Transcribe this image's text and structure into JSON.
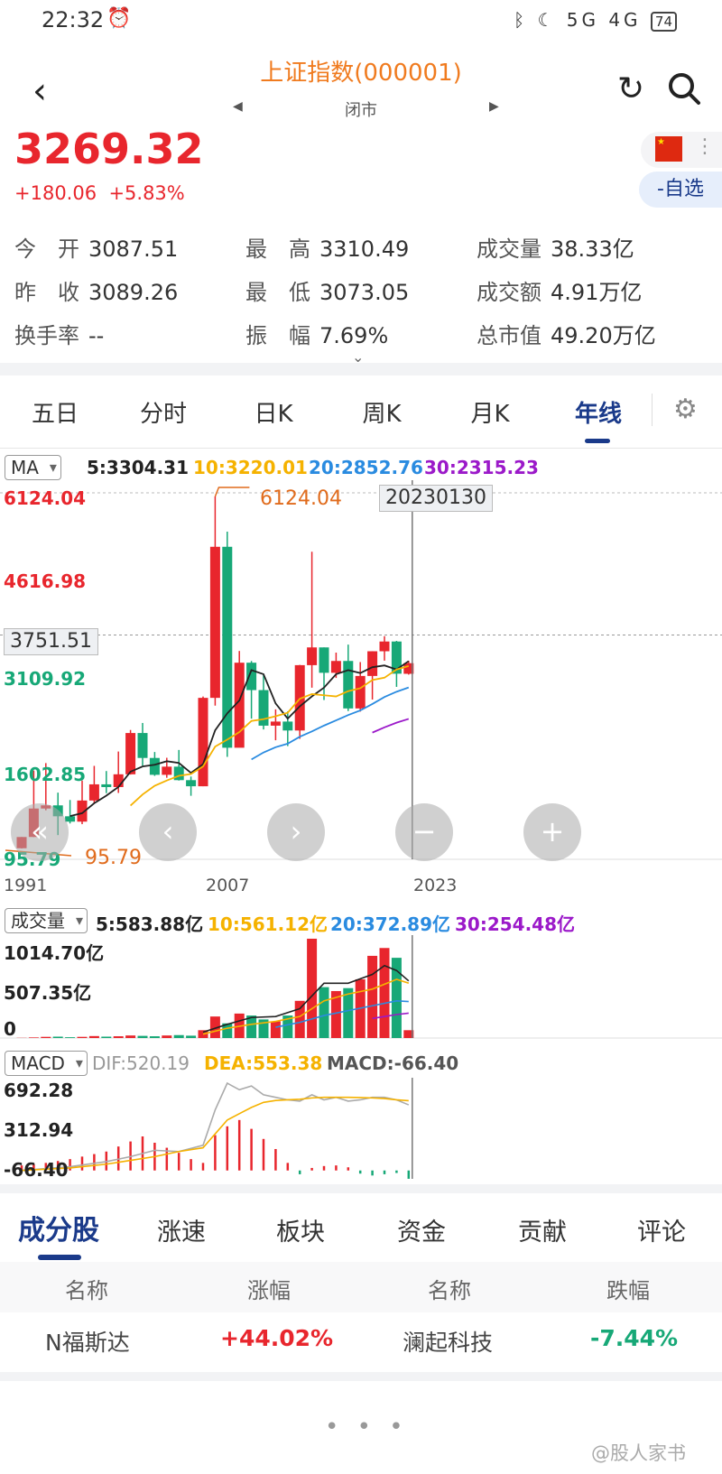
{
  "status": {
    "time": "22:32",
    "alarm_icon": "alarm-icon",
    "icons": "ᛒ ☾ 5G 4G",
    "battery": "74"
  },
  "header": {
    "title": "上证指数(000001)",
    "subtitle": "闭市",
    "back_icon": "back-icon",
    "refresh_icon": "refresh-icon",
    "search_icon": "search-icon"
  },
  "quote": {
    "price": "3269.32",
    "change": "+180.06",
    "change_pct": "+5.83%",
    "add_watch": "-自选",
    "more_icon": "more-icon",
    "stats": [
      {
        "label": "今　开",
        "value": "3087.51"
      },
      {
        "label": "最　高",
        "value": "3310.49"
      },
      {
        "label": "成交量",
        "value": "38.33亿"
      },
      {
        "label": "昨　收",
        "value": "3089.26"
      },
      {
        "label": "最　低",
        "value": "3073.05"
      },
      {
        "label": "成交额",
        "value": "4.91万亿"
      },
      {
        "label": "换手率",
        "value": "--"
      },
      {
        "label": "振　幅",
        "value": "7.69%"
      },
      {
        "label": "总市值",
        "value": "49.20万亿"
      }
    ]
  },
  "tabs": [
    "五日",
    "分时",
    "日K",
    "周K",
    "月K",
    "年线"
  ],
  "active_tab": "年线",
  "colors": {
    "up": "#e8262d",
    "down": "#17a877",
    "ma5": "#222222",
    "ma10": "#f5b200",
    "ma20": "#2a8be0",
    "ma30": "#9b19c9",
    "accent": "#1a3a8a"
  },
  "main_chart": {
    "indicator": "MA",
    "ma": [
      {
        "label": "5:3304.31",
        "color": "#222222"
      },
      {
        "label": "10:3220.01",
        "color": "#f5b200"
      },
      {
        "label": "20:2852.76",
        "color": "#2a8be0"
      },
      {
        "label": "30:2315.23",
        "color": "#9b19c9"
      }
    ],
    "y_labels": [
      "6124.04",
      "4616.98",
      "3109.92",
      "1602.85",
      "95.79"
    ],
    "max_label": "6124.04",
    "min_label": "95.79",
    "crosshair_price": "3751.51",
    "crosshair_date": "20230130",
    "x_labels": [
      "1991",
      "2007",
      "2023"
    ]
  },
  "volume_chart": {
    "indicator": "成交量",
    "ma": [
      {
        "label": "5:583.88亿",
        "color": "#222222"
      },
      {
        "label": "10:561.12亿",
        "color": "#f5b200"
      },
      {
        "label": "20:372.89亿",
        "color": "#2a8be0"
      },
      {
        "label": "30:254.48亿",
        "color": "#9b19c9"
      }
    ],
    "y_labels": [
      "1014.70亿",
      "507.35亿",
      "0"
    ]
  },
  "macd_chart": {
    "indicator": "MACD",
    "dif": "DIF:520.19",
    "dea": "DEA:553.38",
    "macd": "MACD:-66.40",
    "y_labels": [
      "692.28",
      "312.94",
      "-66.40"
    ]
  },
  "chart_controls": [
    "«",
    "‹",
    "›",
    "−",
    "+"
  ],
  "chart_data": {
    "type": "candlestick",
    "x_range": [
      1991,
      2023
    ],
    "ylim": [
      95.79,
      6124.04
    ],
    "candles": [
      {
        "year": 1991,
        "o": 100,
        "c": 292,
        "h": 292,
        "l": 96
      },
      {
        "year": 1992,
        "o": 293,
        "c": 780,
        "h": 1429,
        "l": 292
      },
      {
        "year": 1993,
        "o": 780,
        "c": 834,
        "h": 1558,
        "l": 750
      },
      {
        "year": 1994,
        "o": 834,
        "c": 647,
        "h": 1052,
        "l": 325
      },
      {
        "year": 1995,
        "o": 647,
        "c": 555,
        "h": 926,
        "l": 524
      },
      {
        "year": 1996,
        "o": 555,
        "c": 917,
        "h": 1258,
        "l": 512
      },
      {
        "year": 1997,
        "o": 917,
        "c": 1194,
        "h": 1510,
        "l": 870
      },
      {
        "year": 1998,
        "o": 1194,
        "c": 1147,
        "h": 1422,
        "l": 1043
      },
      {
        "year": 1999,
        "o": 1147,
        "c": 1366,
        "h": 1756,
        "l": 1047
      },
      {
        "year": 2000,
        "o": 1366,
        "c": 2073,
        "h": 2125,
        "l": 1361
      },
      {
        "year": 2001,
        "o": 2073,
        "c": 1646,
        "h": 2245,
        "l": 1514
      },
      {
        "year": 2002,
        "o": 1646,
        "c": 1357,
        "h": 1748,
        "l": 1339
      },
      {
        "year": 2003,
        "o": 1357,
        "c": 1497,
        "h": 1649,
        "l": 1307
      },
      {
        "year": 2004,
        "o": 1497,
        "c": 1266,
        "h": 1783,
        "l": 1259
      },
      {
        "year": 2005,
        "o": 1266,
        "c": 1161,
        "h": 1328,
        "l": 998
      },
      {
        "year": 2006,
        "o": 1161,
        "c": 2675,
        "h": 2698,
        "l": 1161
      },
      {
        "year": 2007,
        "o": 2675,
        "c": 5262,
        "h": 6124,
        "l": 2541
      },
      {
        "year": 2008,
        "o": 5262,
        "c": 1821,
        "h": 5522,
        "l": 1664
      },
      {
        "year": 2009,
        "o": 1821,
        "c": 3277,
        "h": 3478,
        "l": 1844
      },
      {
        "year": 2010,
        "o": 3277,
        "c": 2808,
        "h": 3306,
        "l": 2319
      },
      {
        "year": 2011,
        "o": 2808,
        "c": 2199,
        "h": 3067,
        "l": 2134
      },
      {
        "year": 2012,
        "o": 2199,
        "c": 2269,
        "h": 2478,
        "l": 1949
      },
      {
        "year": 2013,
        "o": 2269,
        "c": 2116,
        "h": 2444,
        "l": 1849
      },
      {
        "year": 2014,
        "o": 2116,
        "c": 3235,
        "h": 3239,
        "l": 1974
      },
      {
        "year": 2015,
        "o": 3235,
        "c": 3539,
        "h": 5178,
        "l": 2850
      },
      {
        "year": 2016,
        "o": 3539,
        "c": 3104,
        "h": 3539,
        "l": 2638
      },
      {
        "year": 2017,
        "o": 3104,
        "c": 3307,
        "h": 3450,
        "l": 3016
      },
      {
        "year": 2018,
        "o": 3307,
        "c": 2494,
        "h": 3587,
        "l": 2449
      },
      {
        "year": 2019,
        "o": 2494,
        "c": 3050,
        "h": 3288,
        "l": 2440
      },
      {
        "year": 2020,
        "o": 3050,
        "c": 3473,
        "h": 3474,
        "l": 2646
      },
      {
        "year": 2021,
        "o": 3473,
        "c": 3640,
        "h": 3731,
        "l": 3312
      },
      {
        "year": 2022,
        "o": 3640,
        "c": 3089,
        "h": 3651,
        "l": 2863
      },
      {
        "year": 2023,
        "o": 3087,
        "c": 3269,
        "h": 3310,
        "l": 3073
      }
    ],
    "ma5": [
      [
        1995,
        650
      ],
      [
        1996,
        700
      ],
      [
        1997,
        870
      ],
      [
        1998,
        1000
      ],
      [
        1999,
        1150
      ],
      [
        2000,
        1410
      ],
      [
        2001,
        1500
      ],
      [
        2002,
        1530
      ],
      [
        2003,
        1590
      ],
      [
        2004,
        1560
      ],
      [
        2005,
        1390
      ],
      [
        2006,
        1540
      ],
      [
        2007,
        2120
      ],
      [
        2008,
        2410
      ],
      [
        2009,
        2630
      ],
      [
        2010,
        3150
      ],
      [
        2011,
        3080
      ],
      [
        2012,
        2580
      ],
      [
        2013,
        2320
      ],
      [
        2014,
        2530
      ],
      [
        2015,
        2700
      ],
      [
        2016,
        2850
      ],
      [
        2017,
        3080
      ],
      [
        2018,
        3150
      ],
      [
        2019,
        3100
      ],
      [
        2020,
        3200
      ],
      [
        2021,
        3230
      ],
      [
        2022,
        3160
      ],
      [
        2023,
        3304
      ]
    ],
    "ma10": [
      [
        2000,
        830
      ],
      [
        2001,
        1020
      ],
      [
        2002,
        1170
      ],
      [
        2003,
        1260
      ],
      [
        2004,
        1340
      ],
      [
        2005,
        1370
      ],
      [
        2006,
        1500
      ],
      [
        2007,
        1840
      ],
      [
        2008,
        1960
      ],
      [
        2009,
        2090
      ],
      [
        2010,
        2280
      ],
      [
        2011,
        2310
      ],
      [
        2012,
        2360
      ],
      [
        2013,
        2420
      ],
      [
        2014,
        2660
      ],
      [
        2015,
        2740
      ],
      [
        2016,
        2720
      ],
      [
        2017,
        2700
      ],
      [
        2018,
        2790
      ],
      [
        2019,
        2840
      ],
      [
        2020,
        2980
      ],
      [
        2021,
        3020
      ],
      [
        2022,
        3160
      ],
      [
        2023,
        3220
      ]
    ],
    "ma20": [
      [
        2010,
        1620
      ],
      [
        2011,
        1740
      ],
      [
        2012,
        1830
      ],
      [
        2013,
        1890
      ],
      [
        2014,
        2010
      ],
      [
        2015,
        2100
      ],
      [
        2016,
        2200
      ],
      [
        2017,
        2290
      ],
      [
        2018,
        2380
      ],
      [
        2019,
        2460
      ],
      [
        2020,
        2570
      ],
      [
        2021,
        2690
      ],
      [
        2022,
        2780
      ],
      [
        2023,
        2853
      ]
    ],
    "ma30": [
      [
        2020,
        2080
      ],
      [
        2021,
        2170
      ],
      [
        2022,
        2250
      ],
      [
        2023,
        2315
      ]
    ],
    "volume_ylim": [
      0,
      1014.7
    ],
    "volume": [
      2,
      6,
      12,
      14,
      8,
      12,
      20,
      14,
      18,
      26,
      22,
      18,
      26,
      30,
      24,
      80,
      220,
      150,
      250,
      230,
      190,
      170,
      230,
      380,
      1015,
      520,
      480,
      510,
      600,
      840,
      920,
      820,
      80
    ],
    "macd_ylim": [
      -66.4,
      692.28
    ],
    "dif": [
      [
        1991,
        0
      ],
      [
        1995,
        30
      ],
      [
        1998,
        70
      ],
      [
        2000,
        110
      ],
      [
        2002,
        160
      ],
      [
        2004,
        150
      ],
      [
        2006,
        200
      ],
      [
        2007,
        480
      ],
      [
        2008,
        692
      ],
      [
        2009,
        640
      ],
      [
        2010,
        670
      ],
      [
        2011,
        600
      ],
      [
        2012,
        580
      ],
      [
        2013,
        560
      ],
      [
        2014,
        550
      ],
      [
        2015,
        600
      ],
      [
        2016,
        560
      ],
      [
        2017,
        580
      ],
      [
        2018,
        550
      ],
      [
        2019,
        560
      ],
      [
        2020,
        580
      ],
      [
        2021,
        580
      ],
      [
        2022,
        560
      ],
      [
        2023,
        520
      ]
    ],
    "dea": [
      [
        1991,
        0
      ],
      [
        1995,
        20
      ],
      [
        1998,
        50
      ],
      [
        2000,
        80
      ],
      [
        2002,
        110
      ],
      [
        2004,
        150
      ],
      [
        2006,
        180
      ],
      [
        2007,
        290
      ],
      [
        2008,
        400
      ],
      [
        2009,
        450
      ],
      [
        2010,
        500
      ],
      [
        2011,
        540
      ],
      [
        2012,
        555
      ],
      [
        2013,
        560
      ],
      [
        2014,
        565
      ],
      [
        2015,
        575
      ],
      [
        2016,
        580
      ],
      [
        2017,
        580
      ],
      [
        2018,
        580
      ],
      [
        2019,
        578
      ],
      [
        2020,
        575
      ],
      [
        2021,
        570
      ],
      [
        2022,
        560
      ],
      [
        2023,
        553
      ]
    ],
    "macd_hist": [
      40,
      50,
      60,
      75,
      90,
      110,
      130,
      150,
      190,
      230,
      270,
      220,
      180,
      140,
      90,
      60,
      280,
      350,
      400,
      330,
      250,
      170,
      60,
      -30,
      20,
      35,
      40,
      25,
      -25,
      -40,
      -30,
      -20,
      -66
    ]
  },
  "bottom_tabs": [
    "成分股",
    "涨速",
    "板块",
    "资金",
    "贡献",
    "评论"
  ],
  "constituents": {
    "headers": [
      "名称",
      "涨幅",
      "名称",
      "跌幅"
    ],
    "row": {
      "gainer_name": "N福斯达",
      "gainer_pct": "+44.02%",
      "loser_name": "澜起科技",
      "loser_pct": "-7.44%"
    }
  },
  "pager": "• • •",
  "watermark": "@股人家书"
}
